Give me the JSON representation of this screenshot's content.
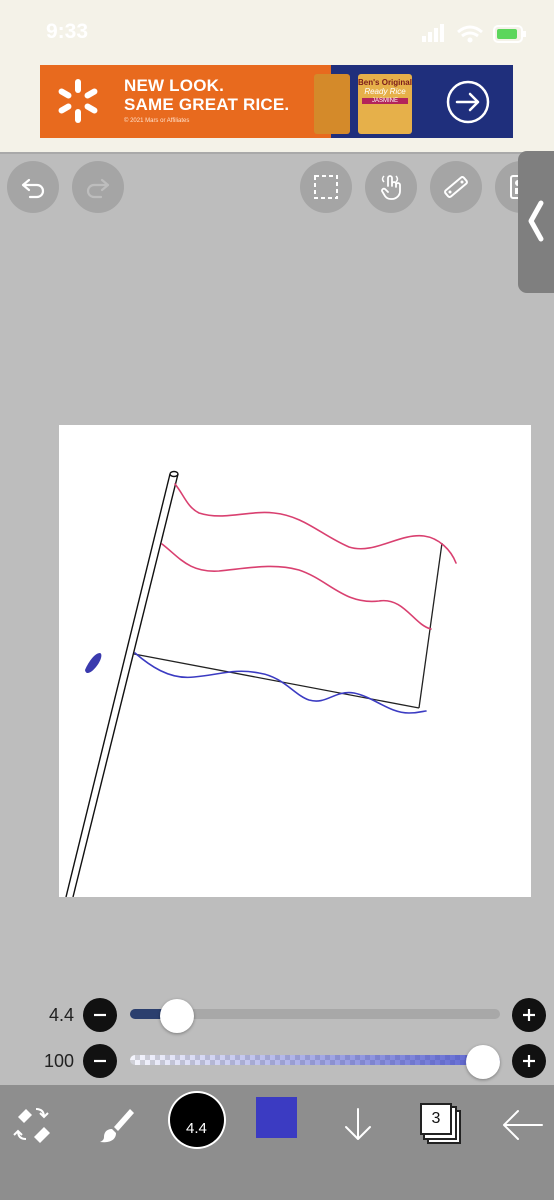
{
  "status": {
    "time": "9:33"
  },
  "ad": {
    "headline_line1": "NEW LOOK.",
    "headline_line2": "SAME GREAT RICE.",
    "legal": "© 2021 Mars or Affiliates",
    "brand": "Ben's Original",
    "product": "Ready Rice",
    "variant": "JASMINE"
  },
  "toolbar": {
    "icons": [
      "undo-icon",
      "redo-icon",
      "selection-icon",
      "touch-icon",
      "ruler-icon",
      "reference-icon"
    ],
    "side_tab_icon": "chevron-left-icon"
  },
  "sliders": {
    "brush_size": {
      "value_label": "4.4",
      "fraction": 0.09
    },
    "opacity": {
      "value_label": "100",
      "fraction": 1.0
    }
  },
  "bottom_bar": {
    "brush_size_label": "4.4",
    "color": "#3b3bc2",
    "layer_count": "3",
    "icons": [
      "transform-eraser-icon",
      "brush-icon",
      "brush-size-icon",
      "color-icon",
      "download-icon",
      "layers-icon",
      "back-arrow-icon"
    ]
  },
  "colors": {
    "accent_blue": "#3b3bc2",
    "flag_red": "#d94070",
    "ad_orange": "#e86a1e"
  }
}
